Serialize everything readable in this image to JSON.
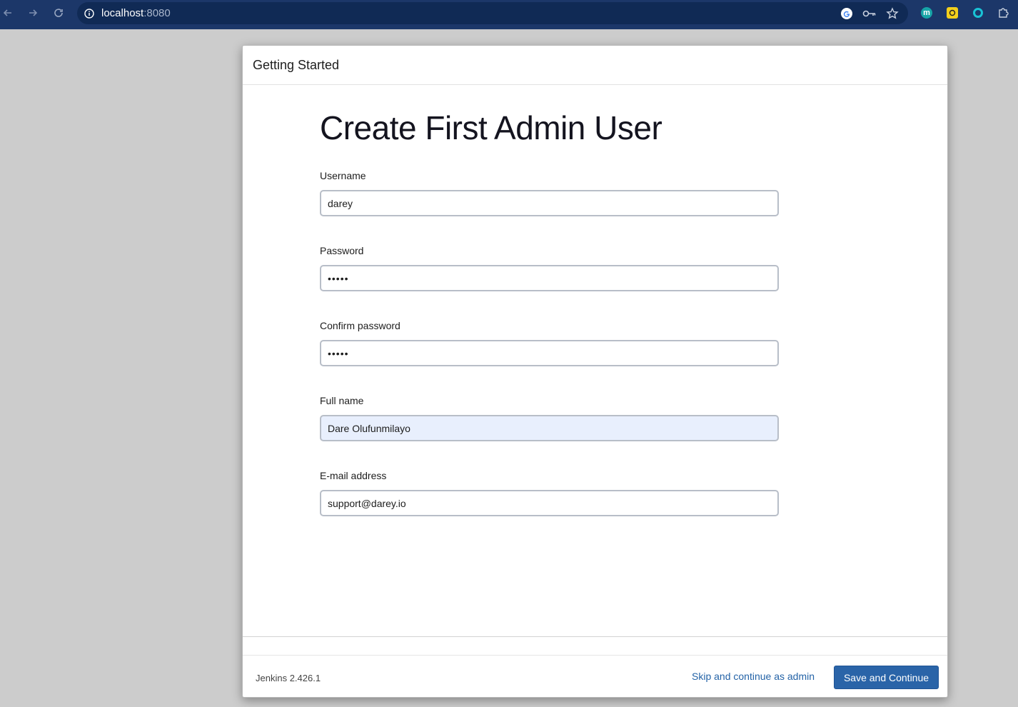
{
  "browser": {
    "url_host": "localhost",
    "url_port": ":8080"
  },
  "dialog": {
    "title": "Getting Started",
    "heading": "Create First Admin User",
    "fields": [
      {
        "label": "Username",
        "value": "darey",
        "type": "text"
      },
      {
        "label": "Password",
        "value": "•••••",
        "type": "password"
      },
      {
        "label": "Confirm password",
        "value": "•••••",
        "type": "password"
      },
      {
        "label": "Full name",
        "value": "Dare Olufunmilayo",
        "type": "text"
      },
      {
        "label": "E-mail address",
        "value": "support@darey.io",
        "type": "text"
      }
    ]
  },
  "footer": {
    "version": "Jenkins 2.426.1",
    "skip_label": "Skip and continue as admin",
    "save_label": "Save and Continue"
  },
  "colors": {
    "toolbar_bg": "#1c3769",
    "primary_button": "#2a64a8",
    "link": "#2463a7",
    "autofill_bg": "#e8effd"
  }
}
